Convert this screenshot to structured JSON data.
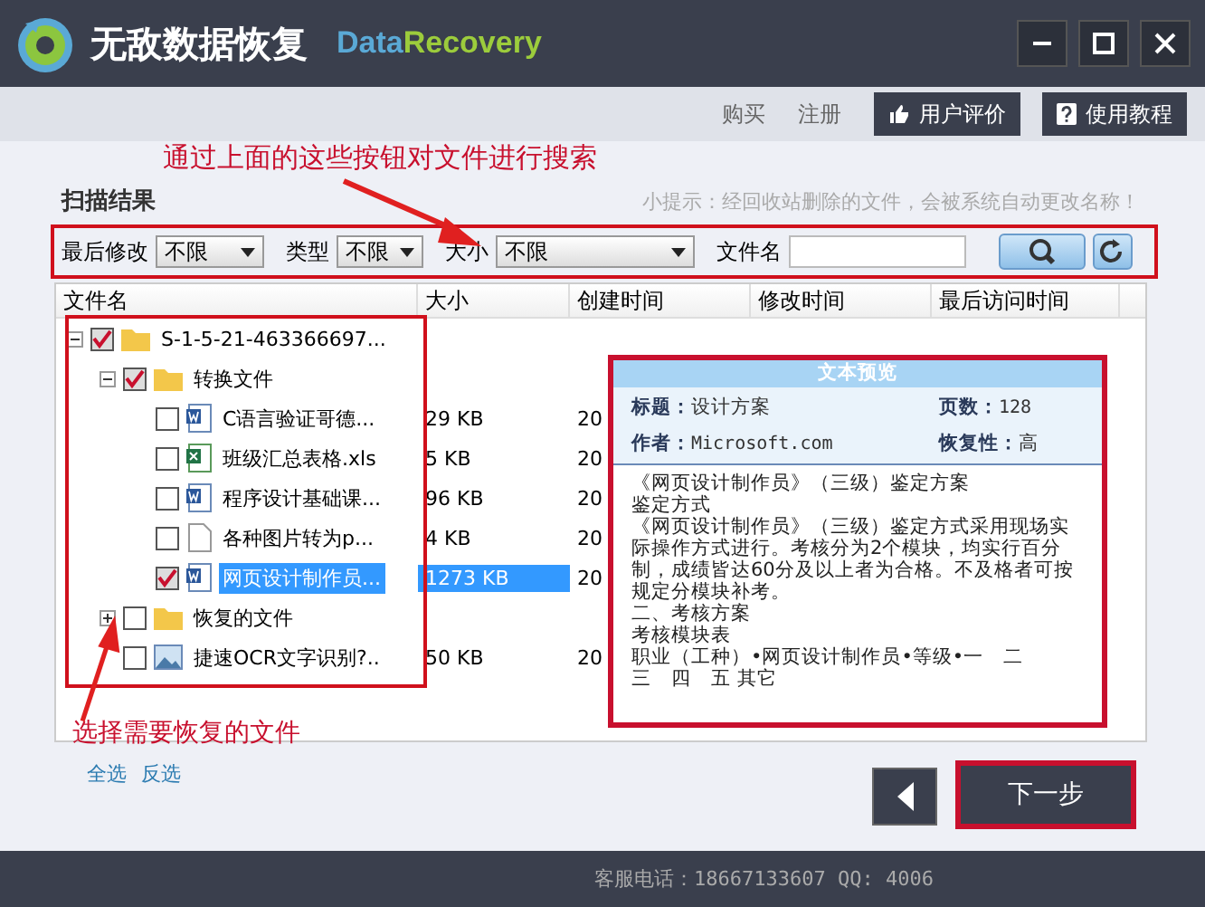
{
  "window": {
    "app_name": "无敌数据恢复",
    "brand_part1": "Data",
    "brand_part2": "Recovery"
  },
  "top_links": [
    "购买",
    "注册"
  ],
  "top_buttons": [
    {
      "kind": "thumb",
      "label": "用户评价"
    },
    {
      "kind": "help",
      "label": "使用教程"
    }
  ],
  "annotation_search": "通过上面的这些按钮对文件进行搜索",
  "section_title": "扫描结果",
  "hint": "小提示：经回收站删除的文件，会被系统自动更改名称！",
  "filters": [
    {
      "label": "最后修改",
      "value": "不限"
    },
    {
      "label": "类型",
      "value": "不限"
    },
    {
      "label": "大小",
      "value": "不限"
    }
  ],
  "filename_filter": {
    "label": "文件名"
  },
  "columns": [
    "文件名",
    "大小",
    "创建时间",
    "修改时间",
    "最后访问时间"
  ],
  "tree": [
    {
      "name": "S-1-5-21-463366697...",
      "kind": "folder",
      "checked": true,
      "selected": false,
      "expanded": true,
      "children": [
        {
          "name": "转换文件",
          "kind": "folder",
          "checked": true,
          "selected": false,
          "expanded": true,
          "children": [
            {
              "name": "C语言验证哥德...",
              "kind": "word",
              "checked": false,
              "selected": false,
              "size": "29 KB",
              "created": "20"
            },
            {
              "name": "班级汇总表格.xls",
              "kind": "excel",
              "checked": false,
              "selected": false,
              "size": "5 KB",
              "created": "20"
            },
            {
              "name": "程序设计基础课...",
              "kind": "word",
              "checked": false,
              "selected": false,
              "size": "96 KB",
              "created": "20"
            },
            {
              "name": "各种图片转为p...",
              "kind": "text",
              "checked": false,
              "selected": false,
              "size": "4 KB",
              "created": "20"
            },
            {
              "name": "网页设计制作员...",
              "kind": "word",
              "checked": true,
              "selected": true,
              "size": "1273 KB",
              "created": "20"
            }
          ]
        },
        {
          "name": "恢复的文件",
          "kind": "folder",
          "checked": false,
          "selected": false,
          "expanded": false
        },
        {
          "name": "捷速OCR文字识别?..",
          "kind": "image",
          "checked": false,
          "selected": false,
          "size": "50 KB",
          "created": "20"
        }
      ]
    }
  ],
  "preview": {
    "title": "文本预览",
    "fields": [
      {
        "label": "标题：",
        "value": "设计方案",
        "mono": false
      },
      {
        "label": "页数：",
        "value": "128",
        "mono": true
      },
      {
        "label": "作者：",
        "value": "Microsoft.com",
        "mono": true
      },
      {
        "label": "恢复性：",
        "value": "高",
        "mono": false
      }
    ],
    "lines": [
      "《网页设计制作员》（三级）鉴定方案",
      "鉴定方式",
      "《网页设计制作员》（三级）鉴定方式采用现场实际操作方式进行。考核分为2个模块，均实行百分制，成绩皆达60分及以上者为合格。不及格者可按规定分模块补考。",
      "二、考核方案",
      "考核模块表",
      "职业（工种）•网页设计制作员•等级•一　二",
      "三　四　五 其它"
    ]
  },
  "annotation_select": "选择需要恢复的文件",
  "select_links": [
    "全选",
    "反选"
  ],
  "next_button": "下一步",
  "status": "客服电话：18667133607 QQ: 4006"
}
